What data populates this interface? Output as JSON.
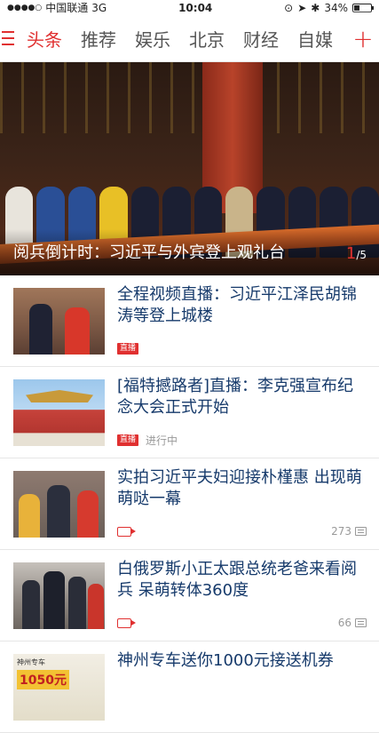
{
  "status_bar": {
    "carrier": "中国联通",
    "network": "3G",
    "time": "10:04",
    "battery": "34%",
    "battery_level": 0.34
  },
  "nav": {
    "tabs": [
      {
        "label": "头条",
        "active": true
      },
      {
        "label": "推荐"
      },
      {
        "label": "娱乐"
      },
      {
        "label": "北京"
      },
      {
        "label": "财经"
      },
      {
        "label": "自媒"
      }
    ],
    "plus_label": "+"
  },
  "hero": {
    "caption": "阅兵倒计时：习近平与外宾登上观礼台",
    "counter_current": "1",
    "counter_total": "/5"
  },
  "articles": [
    {
      "title": "全程视频直播：习近平江泽民胡锦涛等登上城楼",
      "tag": "直播",
      "status": "",
      "comments": ""
    },
    {
      "title": "[福特撼路者]直播：李克强宣布纪念大会正式开始",
      "tag": "直播",
      "status": "进行中",
      "comments": ""
    },
    {
      "title": "实拍习近平夫妇迎接朴槿惠 出现萌萌哒一幕",
      "tag": "video",
      "status": "",
      "comments": "273"
    },
    {
      "title": "白俄罗斯小正太跟总统老爸来看阅兵 呆萌转体360度",
      "tag": "video",
      "status": "",
      "comments": "66"
    },
    {
      "title": "神州专车送你1000元接送机券",
      "tag": "",
      "status": "",
      "comments": "",
      "thumb_text_top": "神州专车",
      "thumb_text_big": "1050元"
    }
  ],
  "colors": {
    "accent": "#e03030",
    "title_blue": "#163a6b"
  }
}
